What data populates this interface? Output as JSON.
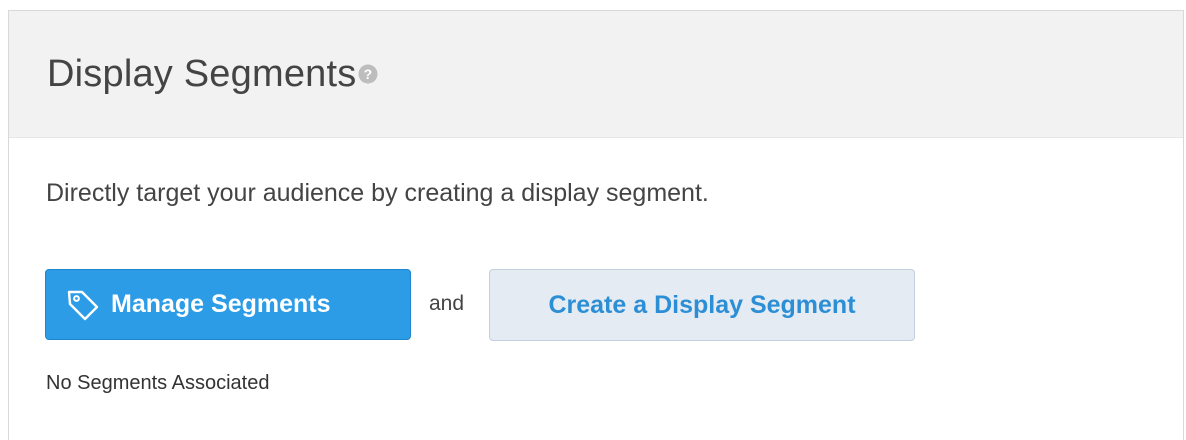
{
  "panel": {
    "title": "Display Segments",
    "help_icon": "question-circle-icon",
    "description": "Directly target your audience by creating a display segment.",
    "manage_button": {
      "icon": "tag-icon",
      "label": "Manage Segments"
    },
    "connector_text": "and",
    "create_button": {
      "label": "Create a Display Segment"
    },
    "status_text": "No Segments Associated"
  },
  "colors": {
    "header_bg": "#f2f2f2",
    "primary_button": "#2c9ce6",
    "secondary_button_bg": "#e5ebf3",
    "secondary_button_text": "#2c8fd6",
    "text": "#444444"
  }
}
